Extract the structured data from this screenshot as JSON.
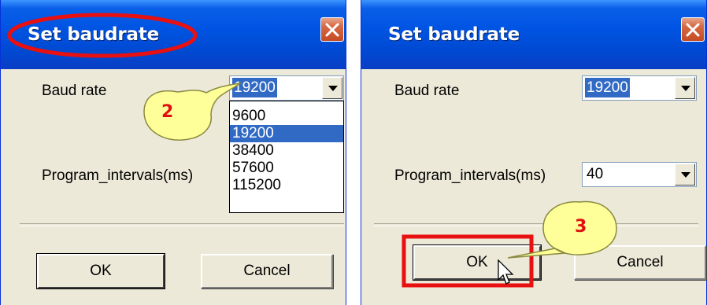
{
  "dialogs": [
    {
      "title": "Set baudrate",
      "baud_label": "Baud rate",
      "baud_value": "19200",
      "interval_label": "Program_intervals(ms)",
      "dropdown_options": [
        "9600",
        "19200",
        "38400",
        "57600",
        "115200"
      ],
      "dropdown_selected": "19200",
      "ok_label": "OK",
      "cancel_label": "Cancel",
      "callout_number": "2"
    },
    {
      "title": "Set baudrate",
      "baud_label": "Baud rate",
      "baud_value": "19200",
      "interval_label": "Program_intervals(ms)",
      "interval_value": "40",
      "ok_label": "OK",
      "cancel_label": "Cancel",
      "callout_number": "3"
    }
  ],
  "colors": {
    "highlight_red": "#e81010",
    "callout_fill": "#ffff99",
    "selection_blue": "#316ac5"
  }
}
